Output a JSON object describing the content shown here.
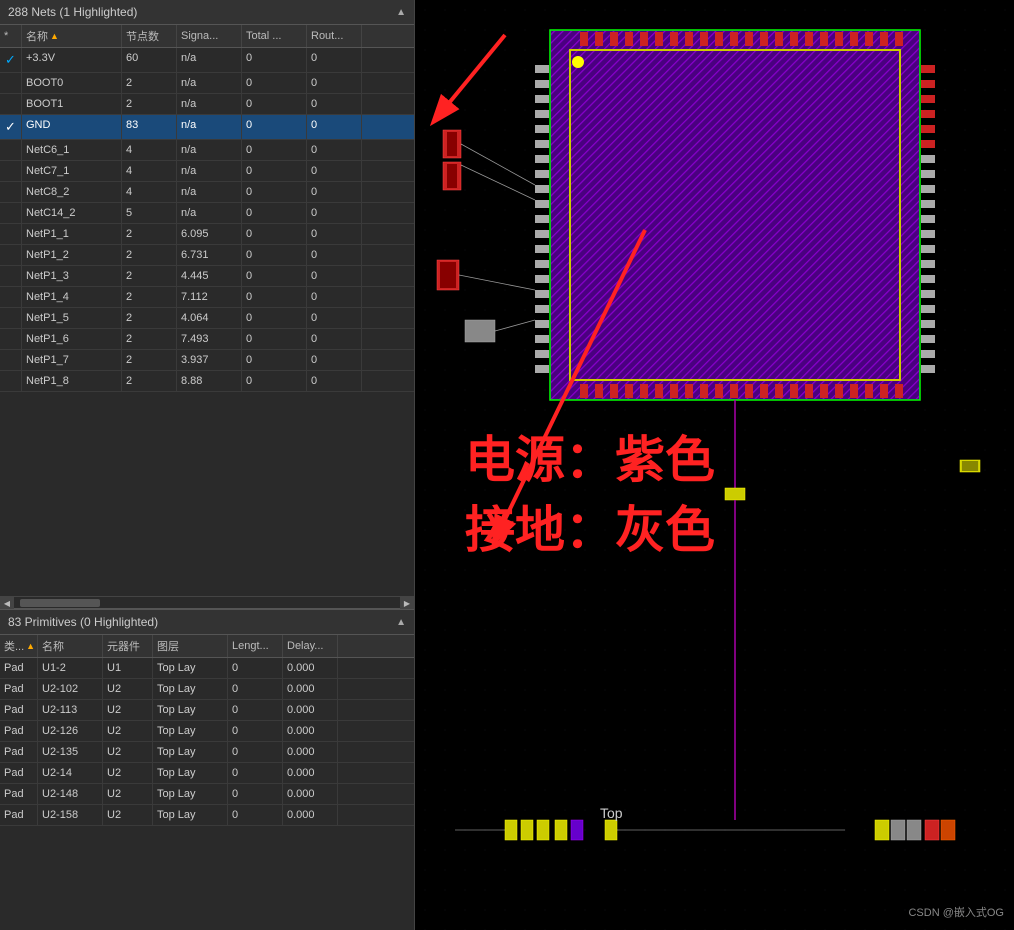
{
  "left_panel": {
    "nets_header": "288 Nets (1 Highlighted)",
    "nets_columns": [
      "*",
      "名称",
      "节点数",
      "Signa...",
      "Total ...",
      "Rout..."
    ],
    "nets_sort_col": "名称",
    "nets": [
      {
        "check": "✓",
        "name": "+3.3V",
        "nodes": "60",
        "signal": "n/a",
        "total": "0",
        "route": "0",
        "highlighted": false
      },
      {
        "check": "",
        "name": "BOOT0",
        "nodes": "2",
        "signal": "n/a",
        "total": "0",
        "route": "0",
        "highlighted": false
      },
      {
        "check": "",
        "name": "BOOT1",
        "nodes": "2",
        "signal": "n/a",
        "total": "0",
        "route": "0",
        "highlighted": false
      },
      {
        "check": "✓",
        "name": "GND",
        "nodes": "83",
        "signal": "n/a",
        "total": "0",
        "route": "0",
        "highlighted": true
      },
      {
        "check": "",
        "name": "NetC6_1",
        "nodes": "4",
        "signal": "n/a",
        "total": "0",
        "route": "0",
        "highlighted": false
      },
      {
        "check": "",
        "name": "NetC7_1",
        "nodes": "4",
        "signal": "n/a",
        "total": "0",
        "route": "0",
        "highlighted": false
      },
      {
        "check": "",
        "name": "NetC8_2",
        "nodes": "4",
        "signal": "n/a",
        "total": "0",
        "route": "0",
        "highlighted": false
      },
      {
        "check": "",
        "name": "NetC14_2",
        "nodes": "5",
        "signal": "n/a",
        "total": "0",
        "route": "0",
        "highlighted": false
      },
      {
        "check": "",
        "name": "NetP1_1",
        "nodes": "2",
        "signal": "6.095",
        "total": "0",
        "route": "0",
        "highlighted": false
      },
      {
        "check": "",
        "name": "NetP1_2",
        "nodes": "2",
        "signal": "6.731",
        "total": "0",
        "route": "0",
        "highlighted": false
      },
      {
        "check": "",
        "name": "NetP1_3",
        "nodes": "2",
        "signal": "4.445",
        "total": "0",
        "route": "0",
        "highlighted": false
      },
      {
        "check": "",
        "name": "NetP1_4",
        "nodes": "2",
        "signal": "7.112",
        "total": "0",
        "route": "0",
        "highlighted": false
      },
      {
        "check": "",
        "name": "NetP1_5",
        "nodes": "2",
        "signal": "4.064",
        "total": "0",
        "route": "0",
        "highlighted": false
      },
      {
        "check": "",
        "name": "NetP1_6",
        "nodes": "2",
        "signal": "7.493",
        "total": "0",
        "route": "0",
        "highlighted": false
      },
      {
        "check": "",
        "name": "NetP1_7",
        "nodes": "2",
        "signal": "3.937",
        "total": "0",
        "route": "0",
        "highlighted": false
      },
      {
        "check": "",
        "name": "NetP1_8",
        "nodes": "2",
        "signal": "8.88",
        "total": "0",
        "route": "0",
        "highlighted": false
      }
    ],
    "primitives_header": "83 Primitives (0 Highlighted)",
    "primitives_columns": [
      "类...",
      "名称",
      "元器件",
      "图层",
      "Lengt...",
      "Delay..."
    ],
    "primitives": [
      {
        "type": "Pad",
        "name": "U1-2",
        "component": "U1",
        "layer": "Top Lay",
        "length": "0",
        "delay": "0.000"
      },
      {
        "type": "Pad",
        "name": "U2-102",
        "component": "U2",
        "layer": "Top Lay",
        "length": "0",
        "delay": "0.000"
      },
      {
        "type": "Pad",
        "name": "U2-113",
        "component": "U2",
        "layer": "Top Lay",
        "length": "0",
        "delay": "0.000"
      },
      {
        "type": "Pad",
        "name": "U2-126",
        "component": "U2",
        "layer": "Top Lay",
        "length": "0",
        "delay": "0.000"
      },
      {
        "type": "Pad",
        "name": "U2-135",
        "component": "U2",
        "layer": "Top Lay",
        "length": "0",
        "delay": "0.000"
      },
      {
        "type": "Pad",
        "name": "U2-14",
        "component": "U2",
        "layer": "Top Lay",
        "length": "0",
        "delay": "0.000"
      },
      {
        "type": "Pad",
        "name": "U2-148",
        "component": "U2",
        "layer": "Top Lay",
        "length": "0",
        "delay": "0.000"
      },
      {
        "type": "Pad",
        "name": "U2-158",
        "component": "U2",
        "layer": "Top Lay",
        "length": "0",
        "delay": "0.000"
      }
    ]
  },
  "annotations": {
    "power_label": "电源：紫色",
    "gnd_label": "接地：灰色",
    "layer_label": "Top"
  },
  "watermark": "CSDN @嵌入式OG"
}
